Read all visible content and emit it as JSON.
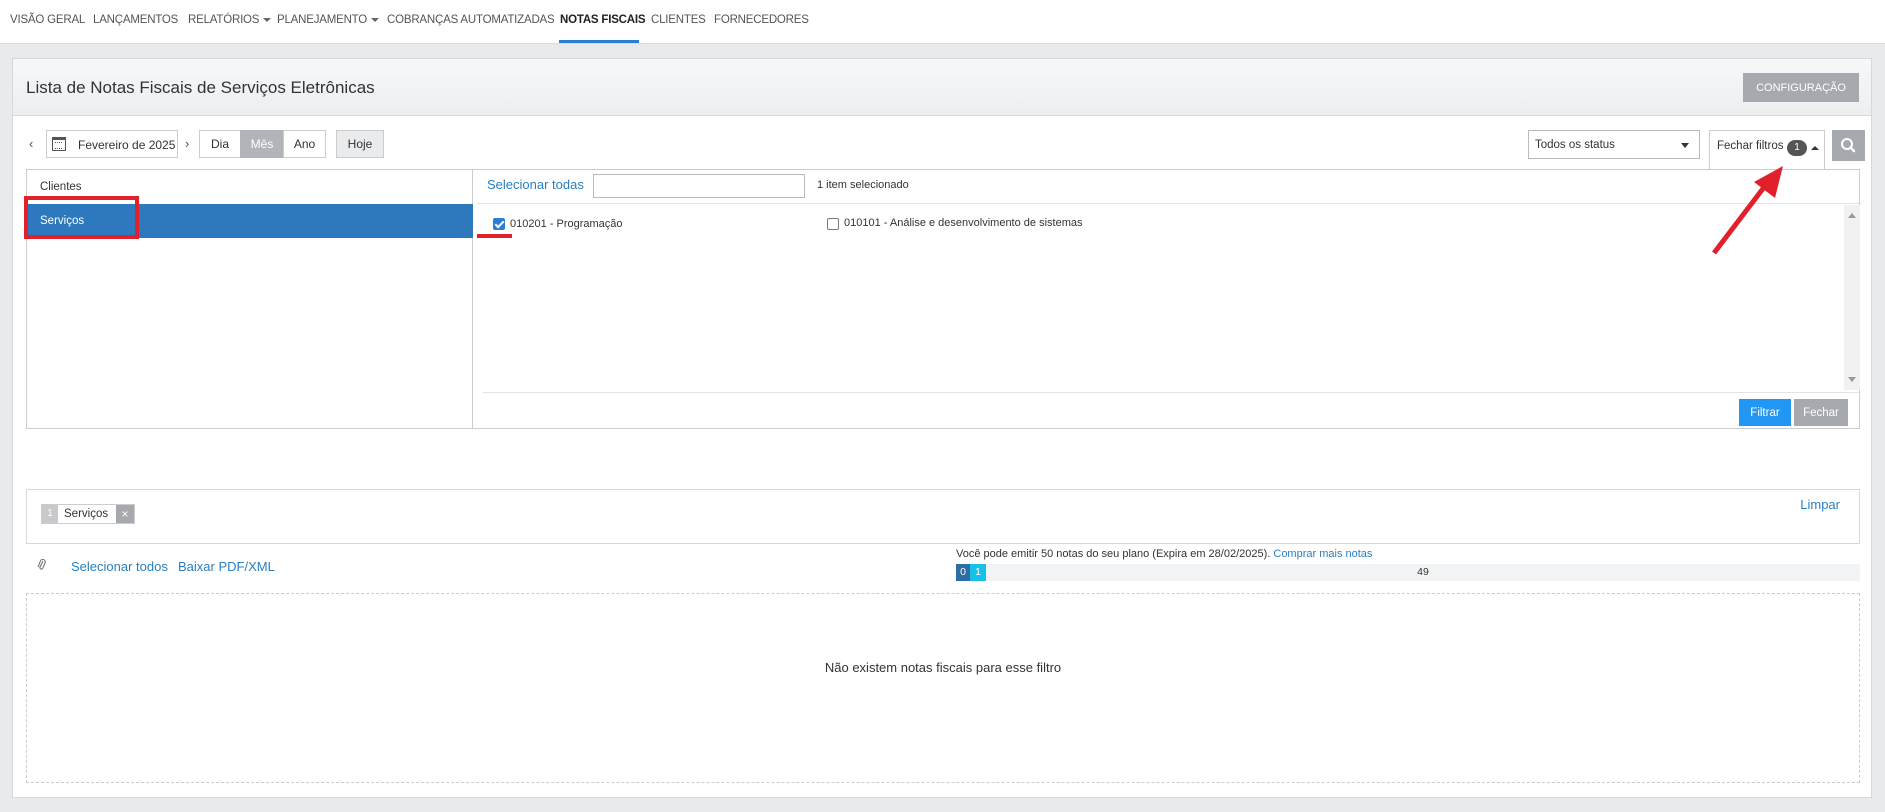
{
  "nav": {
    "items": [
      {
        "label": "VISÃO GERAL",
        "dropdown": false
      },
      {
        "label": "LANÇAMENTOS",
        "dropdown": false
      },
      {
        "label": "RELATÓRIOS",
        "dropdown": true
      },
      {
        "label": "PLANEJAMENTO",
        "dropdown": true
      },
      {
        "label": "COBRANÇAS AUTOMATIZADAS",
        "dropdown": false
      },
      {
        "label": "NOTAS FISCAIS",
        "dropdown": false,
        "active": true
      },
      {
        "label": "CLIENTES",
        "dropdown": false
      },
      {
        "label": "FORNECEDORES",
        "dropdown": false
      }
    ]
  },
  "header": {
    "title": "Lista de Notas Fiscais de Serviços Eletrônicas",
    "config_button": "CONFIGURAÇÃO"
  },
  "toolbar": {
    "period": "Fevereiro de 2025",
    "segments": [
      {
        "label": "Dia",
        "active": false
      },
      {
        "label": "Mês",
        "active": true
      },
      {
        "label": "Ano",
        "active": false
      }
    ],
    "today": "Hoje",
    "status_select": "Todos os status",
    "close_filters": "Fechar filtros",
    "filter_count": "1"
  },
  "filters": {
    "categories": [
      {
        "label": "Clientes",
        "selected": false
      },
      {
        "label": "Serviços",
        "selected": true
      }
    ],
    "select_all": "Selecionar todas",
    "search_value": "",
    "selected_count": "1 item selecionado",
    "options": [
      {
        "label": "010201 - Programação",
        "checked": true
      },
      {
        "label": "010101 - Análise e desenvolvimento de sistemas",
        "checked": false
      }
    ],
    "apply_button": "Filtrar",
    "close_button": "Fechar"
  },
  "active_filters": {
    "chip_count": "1",
    "chip_label": "Serviços",
    "chip_remove": "×",
    "clear": "Limpar"
  },
  "list": {
    "select_all": "Selecionar todos",
    "download": "Baixar PDF/XML",
    "quota_text": "Você pode emitir 50 notas do seu plano (Expira em 28/02/2025).",
    "quota_link": "Comprar mais notas",
    "quota_used": "0",
    "quota_pending": "1",
    "quota_remaining": "49",
    "empty_message": "Não existem notas fiscais para esse filtro"
  },
  "colors": {
    "accent": "#2a7fd4",
    "selected_row": "#2e79be",
    "annotation": "#e0212b",
    "quota_used": "#2e6da4",
    "quota_pending": "#17c0e8"
  }
}
